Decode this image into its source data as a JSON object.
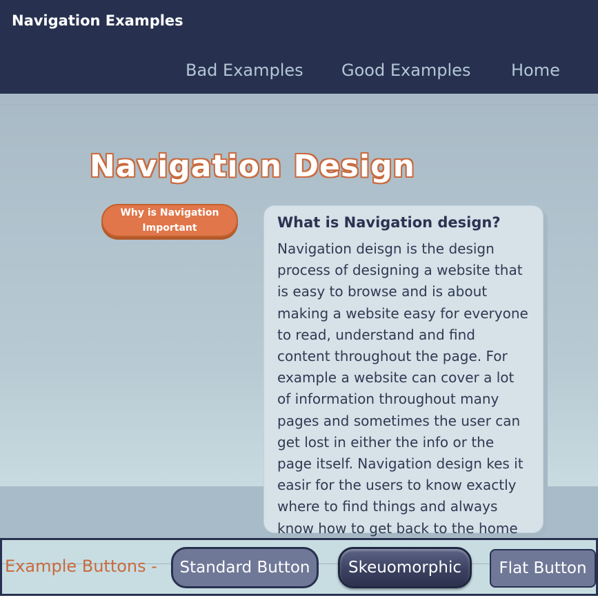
{
  "header": {
    "brand": "Navigation Examples",
    "nav": [
      {
        "label": "Bad Examples"
      },
      {
        "label": "Good Examples"
      },
      {
        "label": "Home"
      }
    ]
  },
  "main": {
    "title": "Navigation Design",
    "why_button_label": "Why is Navigation Important",
    "card": {
      "heading": "What is Navigation design?",
      "body": "Navigation deisgn is the design process of designing a website that is easy to browse and is about making a website easy for everyone to read, understand and find content throughout the page. For example a website can cover a lot of information throughout many pages and sometimes the user can get lost in either the info or the page itself. Navigation design kes it easir for the users to know exactly where to find things and always know how to get back to the home page."
    }
  },
  "examples": {
    "label": "Example Buttons -",
    "buttons": [
      {
        "label": "Standard Button"
      },
      {
        "label": "Skeuomorphic"
      },
      {
        "label": "Flat Button"
      }
    ]
  },
  "colors": {
    "header_bg": "#27314f",
    "accent_orange": "#e0764a",
    "title_outline": "#c96a3e",
    "card_bg": "#d6e1e8"
  }
}
